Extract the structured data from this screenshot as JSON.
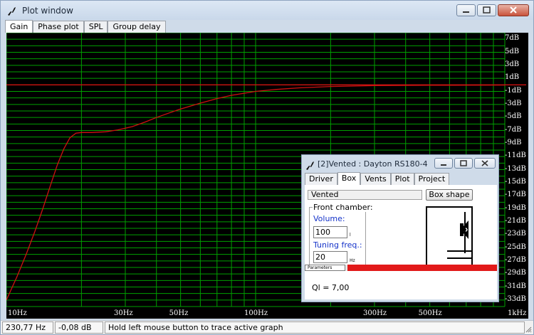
{
  "window": {
    "title": "Plot window",
    "tabs": [
      {
        "label": "Gain",
        "active": true
      },
      {
        "label": "Phase plot",
        "active": false
      },
      {
        "label": "SPL",
        "active": false
      },
      {
        "label": "Group delay",
        "active": false
      }
    ]
  },
  "colors": {
    "grid": "#00a000",
    "curve": "#d01010",
    "background": "#000000"
  },
  "chart_data": {
    "type": "line",
    "x_scale": "log",
    "xlim": [
      10,
      1000
    ],
    "ylim": [
      -34,
      8
    ],
    "x_ticks": [
      {
        "value": 10,
        "label": "10Hz"
      },
      {
        "value": 30,
        "label": "30Hz"
      },
      {
        "value": 50,
        "label": "50Hz"
      },
      {
        "value": 100,
        "label": "100Hz"
      },
      {
        "value": 300,
        "label": "300Hz"
      },
      {
        "value": 500,
        "label": "500Hz"
      },
      {
        "value": 1000,
        "label": "1kHz"
      }
    ],
    "y_ticks": [
      {
        "value": 7,
        "label": "7dB"
      },
      {
        "value": 5,
        "label": "5dB"
      },
      {
        "value": 3,
        "label": "3dB"
      },
      {
        "value": 1,
        "label": "1dB"
      },
      {
        "value": -1,
        "label": "-1dB"
      },
      {
        "value": -3,
        "label": "-3dB"
      },
      {
        "value": -5,
        "label": "-5dB"
      },
      {
        "value": -7,
        "label": "-7dB"
      },
      {
        "value": -9,
        "label": "-9dB"
      },
      {
        "value": -11,
        "label": "-11dB"
      },
      {
        "value": -13,
        "label": "-13dB"
      },
      {
        "value": -15,
        "label": "-15dB"
      },
      {
        "value": -17,
        "label": "-17dB"
      },
      {
        "value": -19,
        "label": "-19dB"
      },
      {
        "value": -21,
        "label": "-21dB"
      },
      {
        "value": -23,
        "label": "-23dB"
      },
      {
        "value": -25,
        "label": "-25dB"
      },
      {
        "value": -27,
        "label": "-27dB"
      },
      {
        "value": -29,
        "label": "-29dB"
      },
      {
        "value": -31,
        "label": "-31dB"
      },
      {
        "value": -33,
        "label": "-33dB"
      }
    ],
    "reference_level": 0,
    "series": [
      {
        "x": [
          10,
          11,
          12,
          13,
          14,
          15,
          16,
          17,
          18,
          19,
          20,
          22,
          25,
          28,
          32,
          36,
          40,
          45,
          50,
          60,
          70,
          80,
          100,
          120,
          150,
          200,
          300,
          500,
          1000
        ],
        "y": [
          -33,
          -29.5,
          -26,
          -22.5,
          -19,
          -15.5,
          -12.3,
          -9.8,
          -8.1,
          -7.4,
          -7.3,
          -7.3,
          -7.2,
          -6.9,
          -6.4,
          -5.7,
          -5,
          -4.3,
          -3.7,
          -2.8,
          -2.1,
          -1.6,
          -1,
          -0.7,
          -0.45,
          -0.25,
          -0.12,
          -0.06,
          -0.03
        ]
      }
    ]
  },
  "statusbar": {
    "frequency": "230,77 Hz",
    "gain": "-0,08 dB",
    "hint": "Hold left mouse button to trace active graph"
  },
  "subwindow": {
    "title": "[2]Vented : Dayton RS180-4",
    "tabs": [
      {
        "label": "Driver",
        "active": false
      },
      {
        "label": "Box",
        "active": true
      },
      {
        "label": "Vents",
        "active": false
      },
      {
        "label": "Plot",
        "active": false
      },
      {
        "label": "Project",
        "active": false
      }
    ],
    "box_type": "Vented",
    "box_shape_label": "Box shape",
    "front_chamber_label": "Front chamber:",
    "volume_label": "Volume:",
    "volume_value": "100",
    "volume_unit": "l",
    "tuning_label": "Tuning freq.:",
    "tuning_value": "20",
    "tuning_unit": "Hz",
    "ql_text": "Ql = 7,00",
    "parameters_label": "Parameters",
    "progress": 1.0
  }
}
